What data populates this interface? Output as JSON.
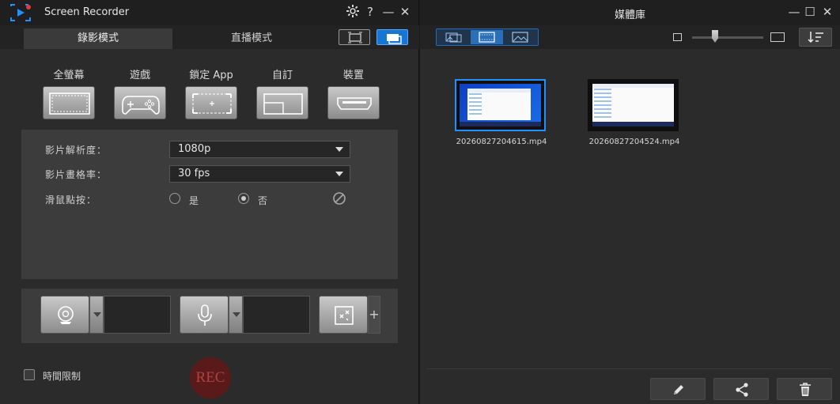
{
  "recorder": {
    "title": "Screen Recorder",
    "titlebar_buttons": [
      "settings",
      "help",
      "minimize",
      "close"
    ],
    "help_label": "?",
    "minimize_label": "—",
    "close_label": "✕",
    "tabs": [
      {
        "label": "錄影模式",
        "active": true
      },
      {
        "label": "直播模式",
        "active": false
      }
    ],
    "targets": [
      {
        "label": "全螢幕",
        "icon": "fullscreen-icon"
      },
      {
        "label": "遊戲",
        "icon": "gamepad-icon"
      },
      {
        "label": "鎖定 App",
        "icon": "lock-app-icon"
      },
      {
        "label": "自訂",
        "icon": "custom-area-icon"
      },
      {
        "label": "裝置",
        "icon": "hdmi-device-icon"
      }
    ],
    "settings": {
      "resolution_label": "影片解析度：",
      "resolution_value": "1080p",
      "framerate_label": "影片畫格率：",
      "framerate_value": "30 fps",
      "mouse_label": "滑鼠點按：",
      "mouse_options": [
        {
          "label": "是",
          "selected": false
        },
        {
          "label": "否",
          "selected": true
        }
      ]
    },
    "time_limit_label": "時間限制",
    "time_limit_checked": false,
    "rec_label": "REC",
    "plus_label": "+"
  },
  "library": {
    "title": "媒體庫",
    "minimize_label": "—",
    "maximize_label": "☐",
    "close_label": "✕",
    "sort_label": "↓☰",
    "items": [
      {
        "filename": "20260827204615.mp4",
        "selected": true
      },
      {
        "filename": "20260827204524.mp4",
        "selected": false
      }
    ],
    "actions": [
      "edit",
      "share",
      "delete"
    ]
  },
  "colors": {
    "accent": "#1e90ff",
    "rec": "#5b1a1a",
    "panel": "#3c3c3c"
  }
}
